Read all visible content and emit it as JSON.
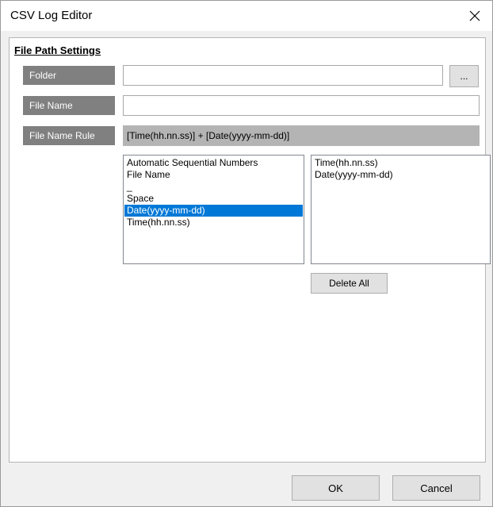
{
  "window": {
    "title": "CSV Log Editor"
  },
  "section": {
    "title": "File Path Settings"
  },
  "fields": {
    "folder_label": "Folder",
    "folder_value": "",
    "browse_label": "...",
    "file_name_label": "File Name",
    "file_name_value": "",
    "file_name_rule_label": "File Name Rule",
    "file_name_rule_value": "[Time(hh.nn.ss)] + [Date(yyyy-mm-dd)]"
  },
  "available_items": [
    {
      "label": "Automatic Sequential Numbers",
      "selected": false
    },
    {
      "label": "File Name",
      "selected": false
    },
    {
      "label": "_",
      "selected": false
    },
    {
      "label": "Space",
      "selected": false
    },
    {
      "label": "Date(yyyy-mm-dd)",
      "selected": true
    },
    {
      "label": "Time(hh.nn.ss)",
      "selected": false
    }
  ],
  "selected_items": [
    {
      "label": "Time(hh.nn.ss)"
    },
    {
      "label": "Date(yyyy-mm-dd)"
    }
  ],
  "buttons": {
    "delete_all": "Delete All",
    "ok": "OK",
    "cancel": "Cancel"
  },
  "colors": {
    "selection": "#0078d7",
    "label_background": "#808080",
    "rule_background": "#b4b4b4"
  },
  "icons": {
    "close": "close-icon"
  }
}
